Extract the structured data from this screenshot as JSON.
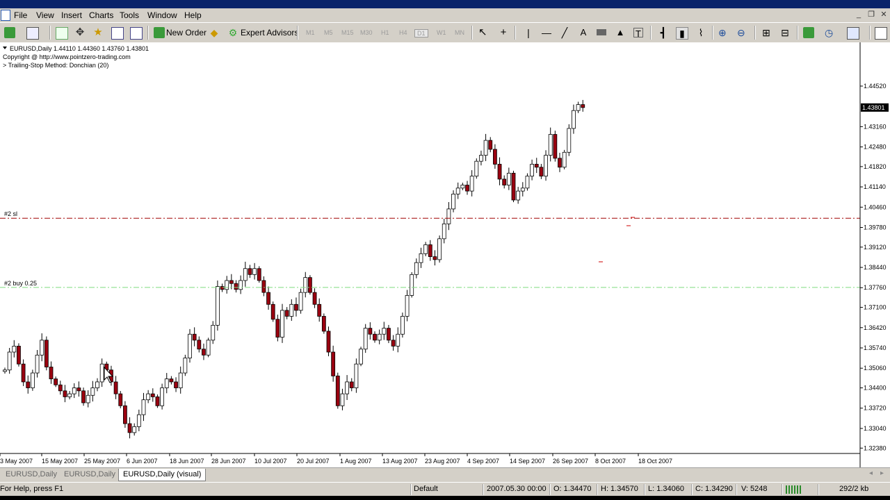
{
  "menu": [
    "File",
    "View",
    "Insert",
    "Charts",
    "Tools",
    "Window",
    "Help"
  ],
  "toolbar": {
    "new_order": "New Order",
    "expert_advisors": "Expert Advisors",
    "timeframes": [
      "M1",
      "M5",
      "M15",
      "M30",
      "H1",
      "H4",
      "D1",
      "W1",
      "MN"
    ],
    "active_timeframe": "D1"
  },
  "chart_info": {
    "header": "EURUSD,Daily  1.44110 1.44360 1.43760 1.43801",
    "copyright": "Copyright @ http://www.pointzero-trading.com",
    "method": "> Trailing-Stop Method: Donchian (20)"
  },
  "chart_data": {
    "type": "candlestick",
    "symbol": "EURUSD",
    "timeframe": "Daily",
    "last_price": "1.43801",
    "price_ticks": [
      "1.44520",
      "1.43160",
      "1.42480",
      "1.41820",
      "1.41140",
      "1.40460",
      "1.39780",
      "1.39120",
      "1.38440",
      "1.37760",
      "1.37100",
      "1.36420",
      "1.35740",
      "1.35060",
      "1.34400",
      "1.33720",
      "1.33040",
      "1.32380"
    ],
    "date_ticks": [
      "3 May 2007",
      "15 May 2007",
      "25 May 2007",
      "6 Jun 2007",
      "18 Jun 2007",
      "28 Jun 2007",
      "10 Jul 2007",
      "20 Jul 2007",
      "1 Aug 2007",
      "13 Aug 2007",
      "23 Aug 2007",
      "4 Sep 2007",
      "14 Sep 2007",
      "26 Sep 2007",
      "8 Oct 2007",
      "18 Oct 2007"
    ],
    "ylim": [
      1.322,
      1.458
    ],
    "lines": [
      {
        "label": "#2 sl",
        "price": 1.4009,
        "color": "#a00000",
        "style": "dash-dot"
      },
      {
        "label": "#2 buy 0.25",
        "price": 1.3777,
        "color": "#7fdc7f",
        "style": "dash-dot"
      }
    ],
    "closes": [
      1.35,
      1.356,
      1.358,
      1.352,
      1.346,
      1.344,
      1.349,
      1.355,
      1.36,
      1.351,
      1.347,
      1.345,
      1.343,
      1.341,
      1.342,
      1.344,
      1.343,
      1.339,
      1.3415,
      1.344,
      1.346,
      1.352,
      1.35,
      1.346,
      1.342,
      1.338,
      1.332,
      1.329,
      1.331,
      1.335,
      1.34,
      1.342,
      1.341,
      1.338,
      1.344,
      1.347,
      1.346,
      1.344,
      1.349,
      1.354,
      1.362,
      1.36,
      1.357,
      1.355,
      1.36,
      1.365,
      1.378,
      1.377,
      1.38,
      1.379,
      1.377,
      1.38,
      1.384,
      1.382,
      1.384,
      1.38,
      1.376,
      1.372,
      1.367,
      1.361,
      1.37,
      1.368,
      1.372,
      1.37,
      1.376,
      1.381,
      1.376,
      1.372,
      1.368,
      1.363,
      1.356,
      1.348,
      1.338,
      1.342,
      1.346,
      1.344,
      1.352,
      1.357,
      1.364,
      1.362,
      1.36,
      1.362,
      1.364,
      1.36,
      1.358,
      1.362,
      1.368,
      1.375,
      1.382,
      1.386,
      1.389,
      1.392,
      1.388,
      1.387,
      1.394,
      1.399,
      1.404,
      1.409,
      1.411,
      1.412,
      1.41,
      1.415,
      1.42,
      1.422,
      1.427,
      1.424,
      1.419,
      1.414,
      1.412,
      1.416,
      1.407,
      1.41,
      1.411,
      1.415,
      1.419,
      1.418,
      1.415,
      1.422,
      1.429,
      1.421,
      1.418,
      1.423,
      1.431,
      1.437,
      1.439,
      1.438
    ],
    "x_start_offset": 7,
    "x_step": 6.65
  },
  "tabs": [
    "EURUSD,Daily",
    "EURUSD,Daily",
    "EURUSD,Daily (visual)"
  ],
  "status": {
    "help": "For Help, press F1",
    "profile": "Default",
    "datetime": "2007.05.30 00:00",
    "open": "O: 1.34470",
    "high": "H: 1.34570",
    "low": "L: 1.34060",
    "close": "C: 1.34290",
    "volume": "V: 5248",
    "traffic": "292/2 kb"
  }
}
